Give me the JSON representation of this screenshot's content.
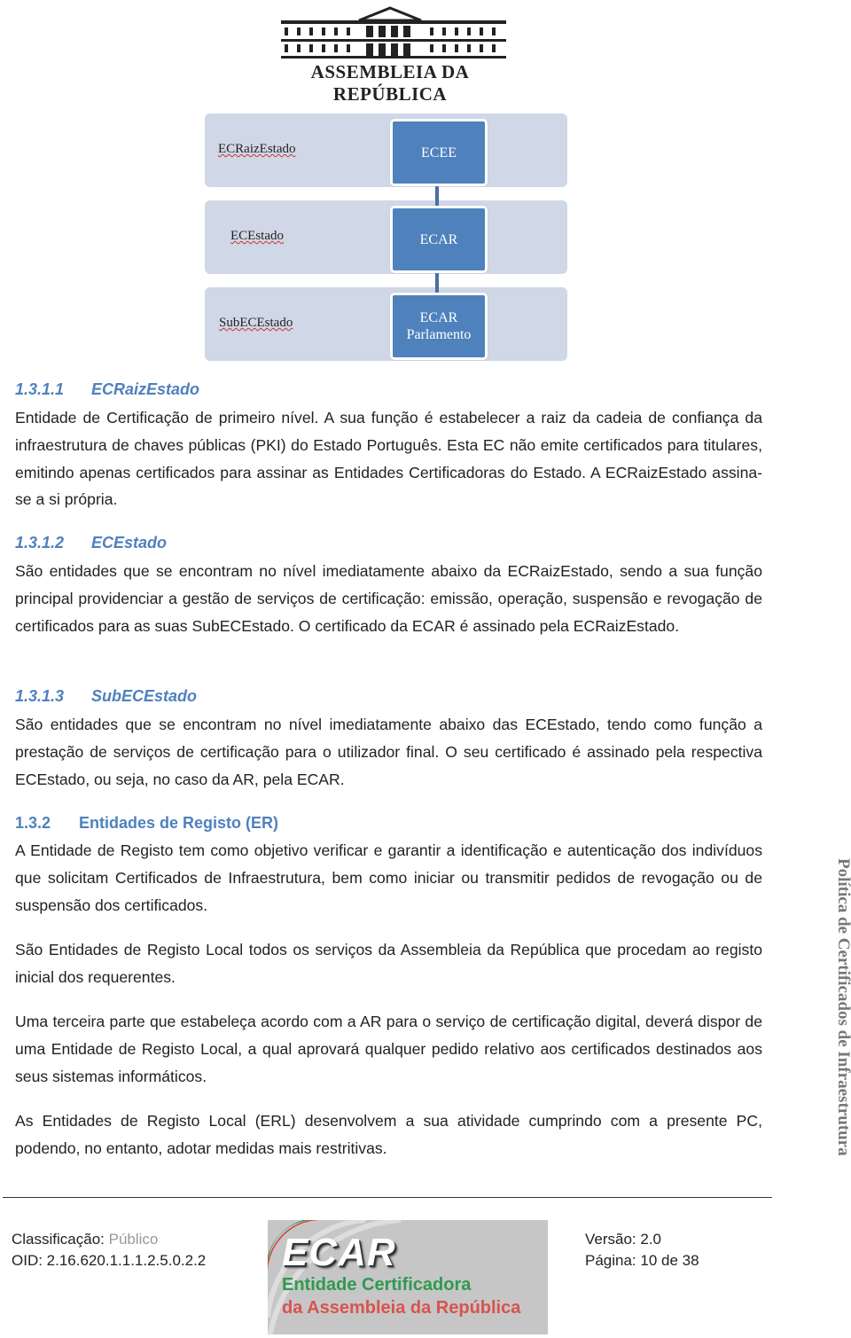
{
  "header": {
    "logo_text": "Assembleia da República"
  },
  "diagram": {
    "levels": [
      {
        "label": "ECRaizEstado",
        "node": "ECEE"
      },
      {
        "label": "ECEstado",
        "node": "ECAR"
      },
      {
        "label": "SubECEstado",
        "node_line1": "ECAR",
        "node_line2": "Parlamento"
      }
    ],
    "colors": {
      "band": "#d0d7e6",
      "node": "#4f81bd"
    }
  },
  "sections": [
    {
      "number": "1.3.1.1",
      "title": "ECRaizEstado",
      "text": "Entidade de Certificação de primeiro nível. A sua função é estabelecer a raiz da cadeia de confiança da infraestrutura de chaves públicas (PKI) do Estado Português. Esta EC não emite certificados para titulares, emitindo apenas certificados para assinar as Entidades Certificadoras do Estado. A ECRaizEstado assina-se a si própria."
    },
    {
      "number": "1.3.1.2",
      "title": "ECEstado",
      "text": "São entidades que se encontram no nível imediatamente abaixo da ECRaizEstado, sendo a sua função principal providenciar a gestão de serviços de certificação: emissão, operação, suspensão e revogação de certificados para as suas SubECEstado. O certificado da ECAR é assinado pela ECRaizEstado."
    },
    {
      "number": "1.3.1.3",
      "title": "SubECEstado",
      "text": "São entidades que se encontram no nível imediatamente abaixo das ECEstado, tendo como função a prestação de serviços de certificação para o utilizador final. O seu certificado é assinado pela respectiva ECEstado, ou seja, no caso da AR, pela ECAR."
    },
    {
      "number": "1.3.2",
      "title": "Entidades de Registo (ER)",
      "paragraphs": [
        "A Entidade de Registo tem como objetivo verificar e garantir a identificação e autenticação dos indivíduos que solicitam Certificados de Infraestrutura, bem como iniciar ou transmitir pedidos de revogação ou de suspensão dos certificados.",
        "São Entidades de Registo Local todos os serviços da Assembleia da República que procedam ao registo inicial dos requerentes.",
        "Uma terceira parte que estabeleça acordo com a AR para o serviço de certificação digital, deverá dispor de uma Entidade de Registo Local, a qual aprovará qualquer pedido relativo aos certificados destinados aos seus sistemas informáticos.",
        "As Entidades de Registo Local (ERL) desenvolvem a sua atividade cumprindo com a presente PC, podendo, no entanto, adotar medidas mais restritivas."
      ]
    }
  ],
  "side_title": "Política de Certificados de Infraestrutura",
  "footer": {
    "classification_label": "Classificação:",
    "classification_value": "Público",
    "oid": "OID: 2.16.620.1.1.1.2.5.0.2.2",
    "version": "Versão: 2.0",
    "page": "Página: 10 de 38",
    "ecar_logo": {
      "title": "ECAR",
      "line1": "Entidade Certificadora",
      "line2": "da Assembleia da República"
    }
  },
  "colors": {
    "heading": "#4f81bd"
  }
}
